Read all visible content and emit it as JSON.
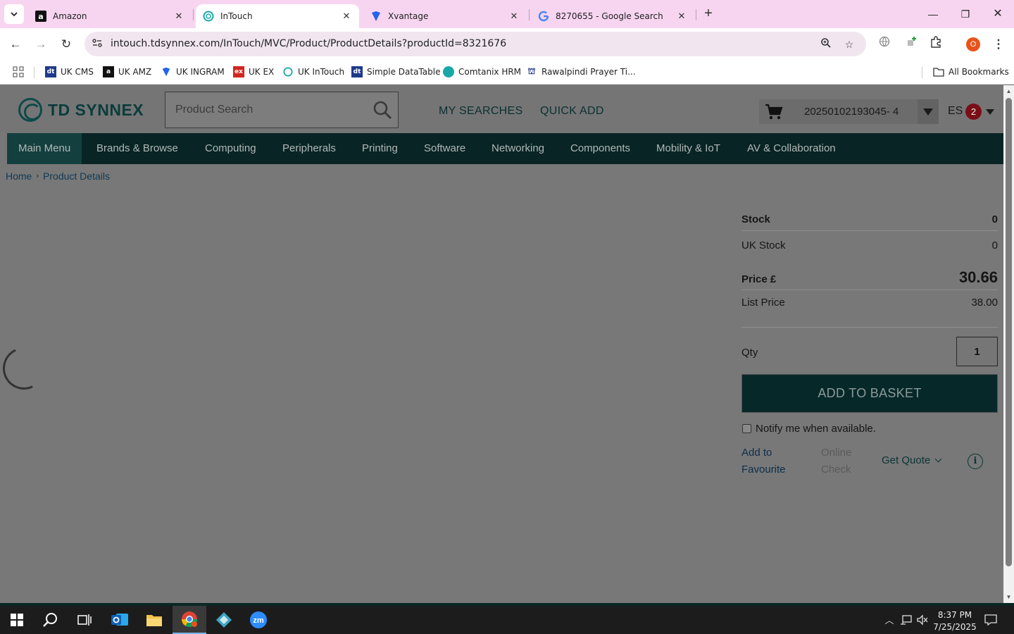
{
  "browser": {
    "tabs": [
      {
        "title": "Amazon",
        "favicon": "amazon-favicon"
      },
      {
        "title": "InTouch",
        "favicon": "intouch-favicon",
        "active": true
      },
      {
        "title": "Xvantage",
        "favicon": "xvantage-favicon"
      },
      {
        "title": "8270655 - Google Search",
        "favicon": "google-favicon"
      }
    ],
    "url": "intouch.tdsynnex.com/InTouch/MVC/Product/ProductDetails?productId=8321676",
    "profile_initial": "O",
    "bookmarks": [
      {
        "label": "UK CMS",
        "color": "#1f3a8a"
      },
      {
        "label": "UK AMZ",
        "color": "#111111"
      },
      {
        "label": "UK INGRAM",
        "color": "#2563eb"
      },
      {
        "label": "UK EX",
        "color": "#d0261f"
      },
      {
        "label": "UK InTouch",
        "color": "#1aa7a7"
      },
      {
        "label": "Simple DataTable",
        "color": "#1f3a8a"
      },
      {
        "label": "Comtanix HRM",
        "color": "#1aa7a7"
      },
      {
        "label": "Rawalpindi Prayer Ti...",
        "color": "#e0a020"
      }
    ],
    "all_bookmarks_label": "All Bookmarks"
  },
  "site": {
    "logo_text": "TD SYNNEX",
    "search_placeholder": "Product Search",
    "links": {
      "my_searches": "MY SEARCHES",
      "quick_add": "QUICK ADD"
    },
    "cart_number": "20250102193045- 4",
    "user_initials": "ES",
    "user_badge": "2",
    "nav": [
      "Main Menu",
      "Brands & Browse",
      "Computing",
      "Peripherals",
      "Printing",
      "Software",
      "Networking",
      "Components",
      "Mobility & IoT",
      "AV & Collaboration"
    ],
    "breadcrumb": [
      "Home",
      "Product Details"
    ]
  },
  "product": {
    "stock_label": "Stock",
    "stock_value": "0",
    "uk_stock_label": "UK Stock",
    "uk_stock_value": "0",
    "price_label": "Price £",
    "price_value": "30.66",
    "list_price_label": "List Price",
    "list_price_value": "38.00",
    "qty_label": "Qty",
    "qty_value": "1",
    "add_to_basket": "ADD TO BASKET",
    "notify_label": "Notify me when available.",
    "add_to_favourite": "Add to Favourite",
    "online_check": "Online Check",
    "get_quote": "Get Quote"
  },
  "taskbar": {
    "time": "8:37 PM",
    "date": "7/25/2025"
  },
  "colors": {
    "tabstrip": "#f7d5f0",
    "nav_bg": "#082424",
    "basket_bg": "#072828",
    "overlay": "#787878"
  }
}
